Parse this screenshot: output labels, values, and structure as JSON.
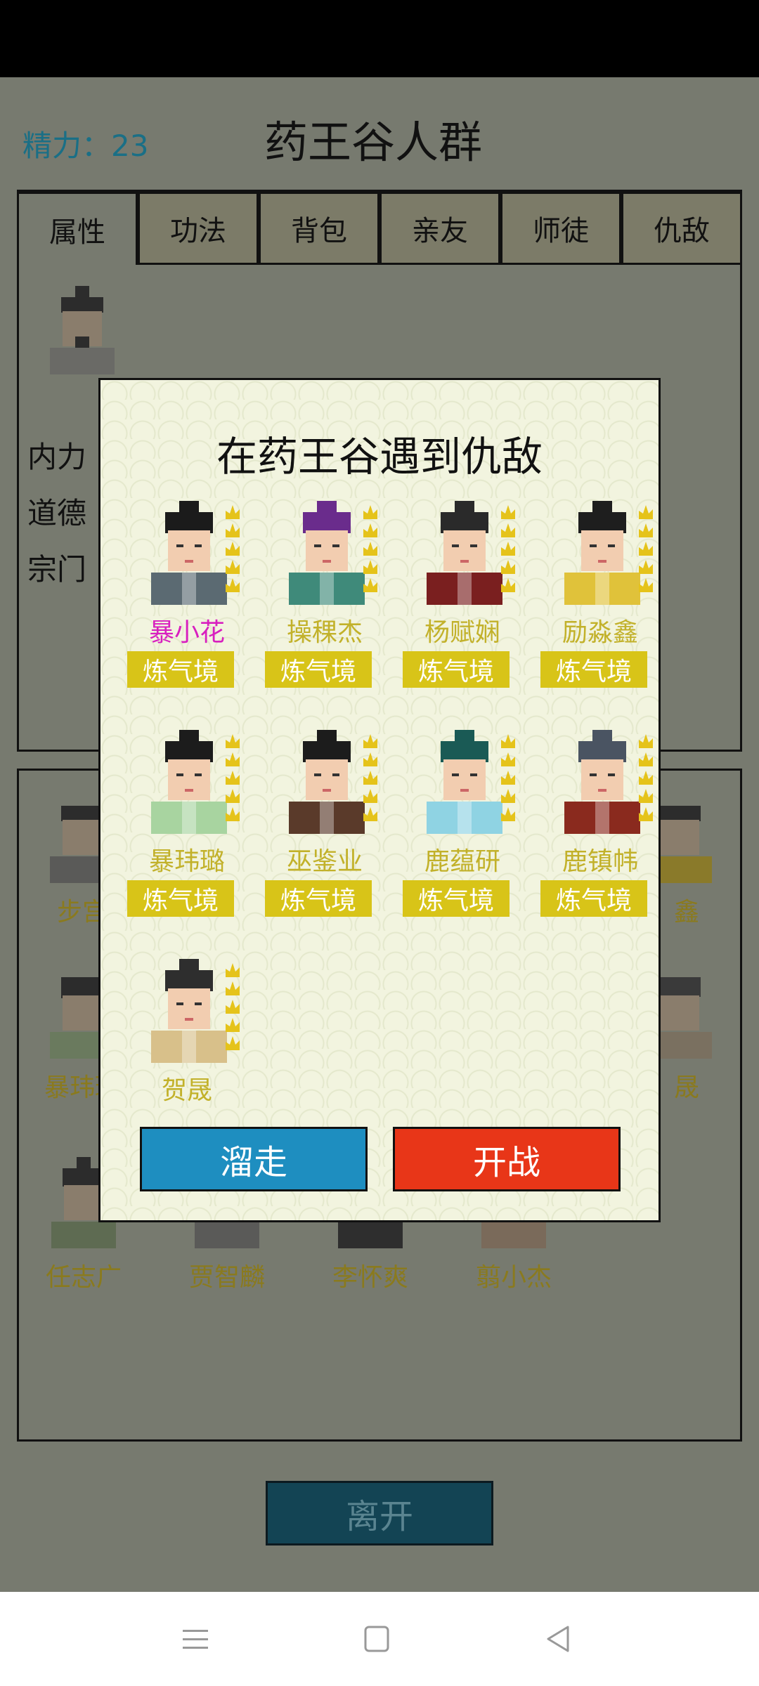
{
  "header": {
    "energy": "精力：23",
    "title": "药王谷人群"
  },
  "tabs": [
    "属性",
    "功法",
    "背包",
    "亲友",
    "师徒",
    "仇敌"
  ],
  "attributes": {
    "row1": "内力",
    "row2": "道德",
    "row3": "宗门"
  },
  "background_people": [
    "步宫",
    "暴玮璐",
    "鑫",
    "晟",
    "任志广",
    "贾智麟",
    "李怀爽",
    "翦小杰"
  ],
  "modal": {
    "title": "在药王谷遇到仇敌",
    "enemies": [
      {
        "name": "暴小花",
        "realm": "炼气境",
        "name_color": "#d81fbf",
        "hair": "#1b1b1b",
        "robe": "#5b6a72",
        "stars": 5
      },
      {
        "name": "操稞杰",
        "realm": "炼气境",
        "name_color": "#c2b12a",
        "hair": "#6a2c8c",
        "robe": "#3f8a7a",
        "stars": 5
      },
      {
        "name": "杨赋娴",
        "realm": "炼气境",
        "name_color": "#c2b12a",
        "hair": "#2a2a2a",
        "robe": "#7a1f1f",
        "stars": 5
      },
      {
        "name": "励淼鑫",
        "realm": "炼气境",
        "name_color": "#c2b12a",
        "hair": "#1e1e1e",
        "robe": "#e0c23a",
        "stars": 5
      },
      {
        "name": "暴玮璐",
        "realm": "炼气境",
        "name_color": "#c2b12a",
        "hair": "#1c1c1c",
        "robe": "#a8d4a0",
        "stars": 5
      },
      {
        "name": "巫鉴业",
        "realm": "炼气境",
        "name_color": "#c2b12a",
        "hair": "#1c1c1c",
        "robe": "#5a3a2a",
        "stars": 5
      },
      {
        "name": "鹿蕴研",
        "realm": "炼气境",
        "name_color": "#c2b12a",
        "hair": "#1a5a55",
        "robe": "#8fd3e3",
        "stars": 5
      },
      {
        "name": "鹿镇帏",
        "realm": "炼气境",
        "name_color": "#c2b12a",
        "hair": "#4a5462",
        "robe": "#8a2a1e",
        "stars": 5
      },
      {
        "name": "贺晟",
        "realm": "",
        "name_color": "#c2b12a",
        "hair": "#2e2e2e",
        "robe": "#d8c08a",
        "stars": 5
      }
    ],
    "flee_label": "溜走",
    "fight_label": "开战"
  },
  "leave_label": "离开",
  "nav": {
    "menu": "menu-icon",
    "home": "home-icon",
    "back": "back-icon"
  }
}
